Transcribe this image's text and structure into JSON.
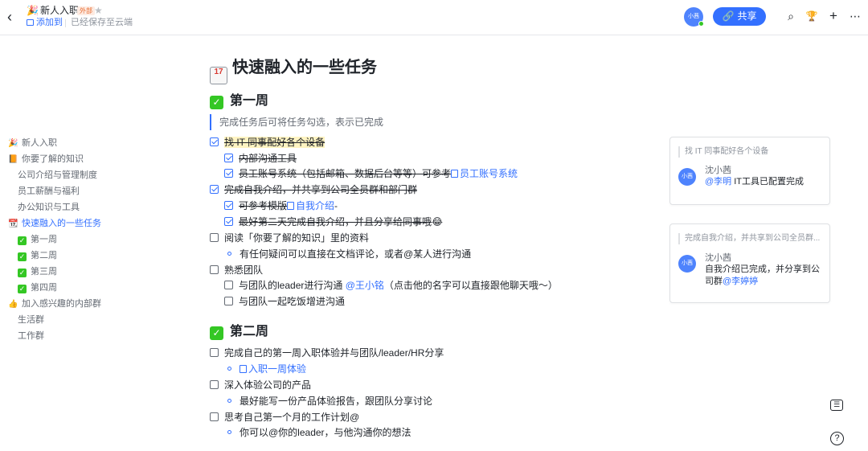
{
  "header": {
    "back_icon": "‹",
    "doc_emoji": "🎉",
    "title": "新人入职",
    "external_badge": "外部",
    "star_icon": "★",
    "add_to": "添加到",
    "saved_status": "已经保存至云端",
    "avatar_label": "小茜",
    "share_label": "共享",
    "share_icon": "🔗",
    "tools": [
      "⌕",
      "🏆",
      "+",
      "⋯"
    ]
  },
  "outline": [
    {
      "label": "新人入职",
      "icon": "🎉",
      "level": 1
    },
    {
      "label": "你要了解的知识",
      "icon": "📙",
      "level": 1
    },
    {
      "label": "公司介绍与管理制度",
      "level": 2
    },
    {
      "label": "员工薪酬与福利",
      "level": 2
    },
    {
      "label": "办公知识与工具",
      "level": 2
    },
    {
      "label": "快速融入的一些任务",
      "icon": "📆",
      "level": 1,
      "active": true
    },
    {
      "label": "第一周",
      "icon": "✓",
      "level": 2,
      "check": true
    },
    {
      "label": "第二周",
      "icon": "✓",
      "level": 2,
      "check": true
    },
    {
      "label": "第三周",
      "icon": "✓",
      "level": 2,
      "check": true
    },
    {
      "label": "第四周",
      "icon": "✓",
      "level": 2,
      "check": true
    },
    {
      "label": "加入感兴趣的内部群",
      "icon": "👍",
      "level": 1
    },
    {
      "label": "生活群",
      "level": 2
    },
    {
      "label": "工作群",
      "level": 2
    }
  ],
  "doc": {
    "h1_icon": "17",
    "h1": "快速融入的一些任务",
    "week1": {
      "icon": "✓",
      "title": "第一周",
      "quote": "完成任务后可将任务勾选，表示已完成",
      "tasks": [
        {
          "text": "找 IT 同事配好各个设备",
          "done": true
        },
        {
          "text": "内部沟通工具",
          "done": true
        },
        {
          "text": "员工账号系统（包括邮箱、数据后台等等）可参考",
          "link": "员工账号系统",
          "done": true
        },
        {
          "text": "完成自我介绍，并共享到公司全员群和部门群",
          "done": true
        },
        {
          "text": "可参考模版",
          "link": "自我介绍",
          "suffix": "-",
          "done": true
        },
        {
          "text": "最好第二天完成自我介绍，并且分享给同事哦",
          "suffix": "😂",
          "done": true
        },
        {
          "text": "阅读「你要了解的知识」里的资料",
          "done": false
        },
        {
          "text": "有任何疑问可以直接在文档评论，或者@某人进行沟通"
        },
        {
          "text": "熟悉团队",
          "done": false
        },
        {
          "text": "与团队的leader进行沟通",
          "mention": "@王小铭",
          "suffix": "（点击他的名字可以直接跟他聊天哦～）",
          "done": false
        },
        {
          "text": "与团队一起吃饭增进沟通",
          "done": false
        }
      ]
    },
    "week2": {
      "icon": "✓",
      "title": "第二周",
      "tasks": [
        {
          "text": "完成自己的第一周入职体验并与团队/leader/HR分享",
          "done": false
        },
        {
          "link": "入职一周体验"
        },
        {
          "text": "深入体验公司的产品",
          "done": false
        },
        {
          "text": "最好能写一份产品体验报告，跟团队分享讨论"
        },
        {
          "text": "思考自己第一个月的工作计划@",
          "done": false
        },
        {
          "text": "你可以@你的leader，与他沟通你的想法"
        }
      ]
    }
  },
  "comments": [
    {
      "quote": "找 IT 同事配好各个设备",
      "author": "沈小茜",
      "avatar": "小茜",
      "mention": "@李明",
      "body": "IT工具已配置完成"
    },
    {
      "quote": "完成自我介绍，并共享到公司全员群...",
      "author": "沈小茜",
      "avatar": "小茜",
      "body": "自我介绍已完成，并分享到公司群",
      "mention": "@李婷婷"
    }
  ],
  "floating": {
    "comment_icon": "☰",
    "help_icon": "?"
  },
  "colors": {
    "accent": "#3370ff",
    "check_green": "#34c724"
  }
}
